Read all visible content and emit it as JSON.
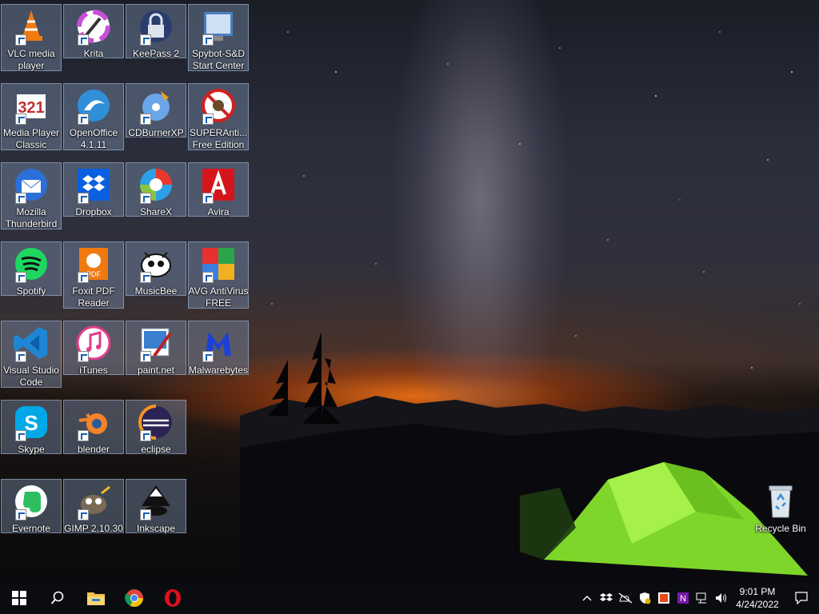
{
  "desktop": {
    "icons": [
      {
        "label": "VLC media player",
        "icon": "vlc-icon"
      },
      {
        "label": "Krita",
        "icon": "krita-icon"
      },
      {
        "label": "KeePass 2",
        "icon": "keepass-icon"
      },
      {
        "label": "Spybot-S&D Start Center",
        "icon": "spybot-icon"
      },
      {
        "label": "Media Player Classic",
        "icon": "mpc-icon"
      },
      {
        "label": "OpenOffice 4.1.11",
        "icon": "openoffice-icon"
      },
      {
        "label": "CDBurnerXP",
        "icon": "cdburnerxp-icon"
      },
      {
        "label": "SUPERAnti... Free Edition",
        "icon": "superantispyware-icon"
      },
      {
        "label": "Mozilla Thunderbird",
        "icon": "thunderbird-icon"
      },
      {
        "label": "Dropbox",
        "icon": "dropbox-icon"
      },
      {
        "label": "ShareX",
        "icon": "sharex-icon"
      },
      {
        "label": "Avira",
        "icon": "avira-icon"
      },
      {
        "label": "Spotify",
        "icon": "spotify-icon"
      },
      {
        "label": "Foxit PDF Reader",
        "icon": "foxit-icon"
      },
      {
        "label": "MusicBee",
        "icon": "musicbee-icon"
      },
      {
        "label": "AVG AntiVirus FREE",
        "icon": "avg-icon"
      },
      {
        "label": "Visual Studio Code",
        "icon": "vscode-icon"
      },
      {
        "label": "iTunes",
        "icon": "itunes-icon"
      },
      {
        "label": "paint.net",
        "icon": "paintnet-icon"
      },
      {
        "label": "Malwarebytes",
        "icon": "malwarebytes-icon"
      },
      {
        "label": "Skype",
        "icon": "skype-icon"
      },
      {
        "label": "blender",
        "icon": "blender-icon"
      },
      {
        "label": "eclipse",
        "icon": "eclipse-icon"
      },
      {
        "label": "Evernote",
        "icon": "evernote-icon"
      },
      {
        "label": "GIMP 2.10.30",
        "icon": "gimp-icon"
      },
      {
        "label": "Inkscape",
        "icon": "inkscape-icon"
      }
    ],
    "recycle_bin": {
      "label": "Recycle Bin",
      "icon": "recycle-bin-icon"
    }
  },
  "taskbar": {
    "pinned": [
      "start-icon",
      "search-icon",
      "file-explorer-icon",
      "chrome-icon",
      "opera-icon"
    ],
    "tray_icons": [
      "chevron-up-icon",
      "dropbox-icon",
      "network-disconnected-icon",
      "security-icon",
      "avast-icon",
      "onenote-icon",
      "network-icon",
      "volume-icon"
    ],
    "clock": {
      "time": "9:01 PM",
      "date": "4/24/2022"
    }
  },
  "colors": {
    "tile_bg": "#788caa",
    "taskbar_bg": "#0b0c10",
    "tent_green": "#8fe830"
  }
}
